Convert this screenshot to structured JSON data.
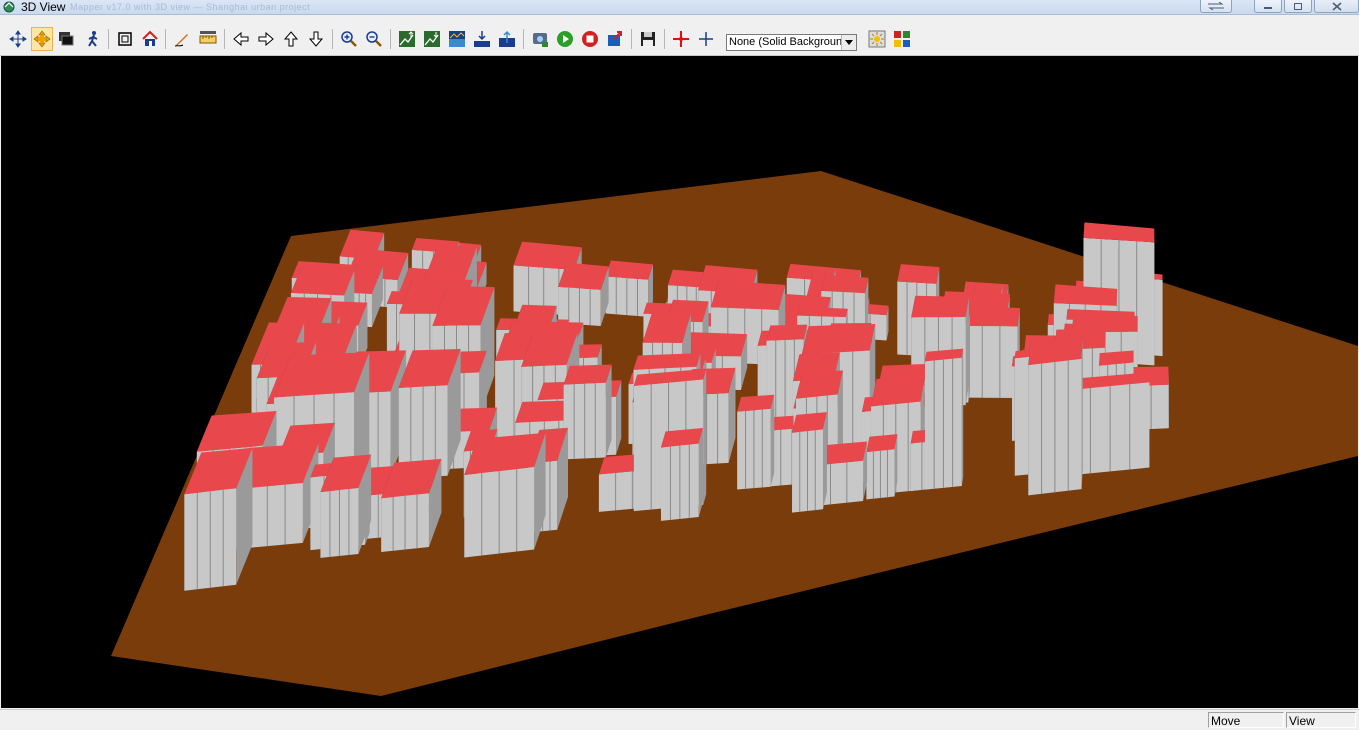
{
  "window": {
    "title": "3D View",
    "doc_title_blurred": "Mapper v17.0 with 3D view — Shanghai urban project",
    "buttons": [
      "minimize",
      "maximize",
      "close"
    ]
  },
  "toolbar": {
    "tools": [
      {
        "name": "pan-icon",
        "tooltip": "Pan"
      },
      {
        "name": "move-icon",
        "tooltip": "Move",
        "active": true
      },
      {
        "name": "layers-icon",
        "tooltip": "Layers"
      },
      {
        "name": "walk-icon",
        "tooltip": "Walk"
      },
      {
        "name": "frame-icon",
        "tooltip": "Frame"
      },
      {
        "name": "home-icon",
        "tooltip": "Home"
      },
      {
        "name": "draw-icon",
        "tooltip": "Draw"
      },
      {
        "name": "ruler-icon",
        "tooltip": "Measure"
      },
      {
        "name": "arrow-left-icon",
        "tooltip": "Left"
      },
      {
        "name": "arrow-right-icon",
        "tooltip": "Right"
      },
      {
        "name": "arrow-up-icon",
        "tooltip": "Up"
      },
      {
        "name": "arrow-down-icon",
        "tooltip": "Down"
      },
      {
        "name": "zoom-in-icon",
        "tooltip": "Zoom In"
      },
      {
        "name": "zoom-out-icon",
        "tooltip": "Zoom Out"
      },
      {
        "name": "vertical-exaggeration-up-icon",
        "tooltip": "Increase Exaggeration"
      },
      {
        "name": "vertical-exaggeration-down-icon",
        "tooltip": "Decrease Exaggeration"
      },
      {
        "name": "water-level-icon",
        "tooltip": "Water Level"
      },
      {
        "name": "lower-icon",
        "tooltip": "Lower"
      },
      {
        "name": "raise-icon",
        "tooltip": "Raise"
      },
      {
        "name": "settings-icon",
        "tooltip": "Settings"
      },
      {
        "name": "play-icon",
        "tooltip": "Play"
      },
      {
        "name": "stop-icon",
        "tooltip": "Stop"
      },
      {
        "name": "export-icon",
        "tooltip": "Export"
      },
      {
        "name": "save-icon",
        "tooltip": "Save"
      },
      {
        "name": "crosshair-red-icon",
        "tooltip": "Crosshair"
      },
      {
        "name": "crosshair-blue-icon",
        "tooltip": "Cursor"
      },
      {
        "name": "lighting-icon",
        "tooltip": "Lighting"
      },
      {
        "name": "options-icon",
        "tooltip": "Options"
      }
    ],
    "background_select": {
      "value": "None (Solid Backgroun"
    }
  },
  "viewport": {
    "colors": {
      "background": "#000000",
      "terrain": "#7a3c0a",
      "roof": "#e8474b",
      "wall_light": "#c8c8c8",
      "wall_dark": "#4b4b4b"
    }
  },
  "statusbar": {
    "mode": "Move",
    "view": "View"
  }
}
